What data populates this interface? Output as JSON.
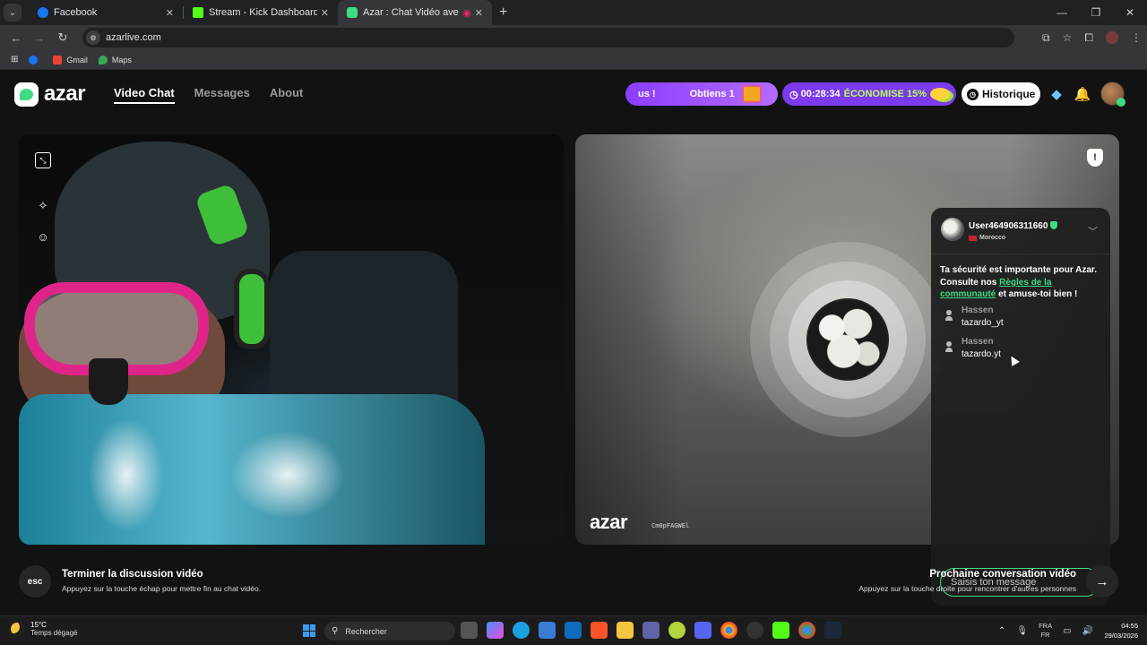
{
  "browser": {
    "tabs": [
      {
        "title": "Facebook",
        "favicon_color": "#1877f2"
      },
      {
        "title": "Stream - Kick Dashboard",
        "favicon_color": "#53fc18"
      },
      {
        "title": "Azar : Chat Vidéo avec de n",
        "favicon_color": "#3ddc84"
      }
    ],
    "url": "azarlive.com",
    "bookmarks": [
      {
        "label": "",
        "color": "#1877f2"
      },
      {
        "label": "Gmail",
        "color": "#ea4335"
      },
      {
        "label": "Maps",
        "color": "#34a853"
      }
    ]
  },
  "app": {
    "logo_text": "azar",
    "nav": [
      {
        "label": "Video Chat"
      },
      {
        "label": "Messages"
      },
      {
        "label": "About"
      }
    ],
    "promo1": {
      "left": "us !",
      "right": "Obtiens 1"
    },
    "promo2": {
      "timer": "00:28:34",
      "save": "ÉCONOMISE 15%"
    },
    "history_label": "Historique",
    "accent": "#3ddc84"
  },
  "partner_video": {
    "watermark": "azar",
    "code": "Cm0pFAGWEl"
  },
  "chat": {
    "user": "User464906311660",
    "country": "Morocco",
    "safety_pre": "Ta sécurité est importante pour Azar. Consulte nos ",
    "safety_link": "Règles de la communauté",
    "safety_post": " et amuse-toi bien !",
    "messages": [
      {
        "name": "Hassen",
        "text": "tazardo_yt"
      },
      {
        "name": "Hassen",
        "text": "tazardo.yt"
      }
    ],
    "input_placeholder": "Saisis ton message"
  },
  "footer": {
    "esc_label": "esc",
    "end_title": "Terminer la discussion vidéo",
    "end_sub": "Appuyez sur la touche échap pour mettre fin au chat vidéo.",
    "next_title": "Prochaine conversation vidéo",
    "next_sub": "Appuyez sur la touche droite pour rencontrer d'autres personnes"
  },
  "taskbar": {
    "temp": "15°C",
    "condition": "Temps dégagé",
    "search_placeholder": "Rechercher",
    "lang_top": "FRA",
    "lang_bottom": "FR",
    "time": "04:55",
    "date": "29/03/2026"
  }
}
